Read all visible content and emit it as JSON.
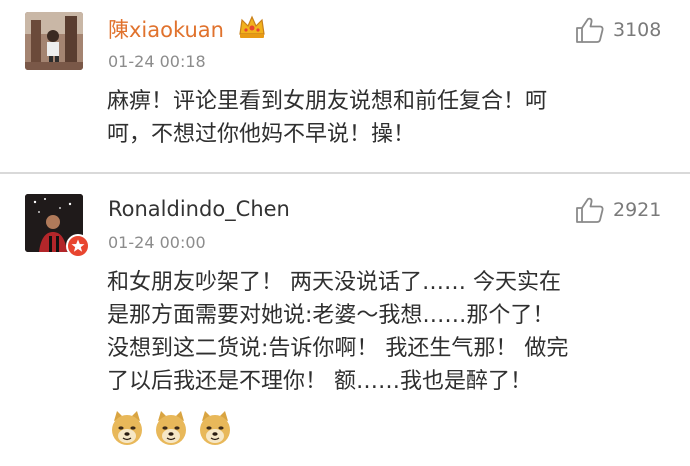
{
  "comments": [
    {
      "username": "陳xiaokuan",
      "timestamp": "01-24 00:18",
      "likes": "3108",
      "lines": [
        "麻痹！评论里看到女朋友说想和前任复合！呵",
        "呵，不想过你他妈不早说！操！"
      ],
      "badge_icon": "crown-icon"
    },
    {
      "username": "Ronaldindo_Chen",
      "timestamp": "01-24 00:00",
      "likes": "2921",
      "lines": [
        "和女朋友吵架了！ 两天没说话了…… 今天实在",
        "是那方面需要对她说:老婆～我想……那个了！",
        "没想到这二货说:告诉你啊！ 我还生气那！ 做完",
        "了以后我还是不理你！  额……我也是醉了！"
      ],
      "badge_icon": "verified-star-icon",
      "emoji_icons": [
        "doge-icon",
        "doge-icon",
        "doge-icon"
      ]
    }
  ],
  "colors": {
    "vip_username": "#e0722d",
    "username": "#333333",
    "meta": "#8c8c8c",
    "badge_red": "#e8452f",
    "crown_gold": "#f2b21d"
  }
}
